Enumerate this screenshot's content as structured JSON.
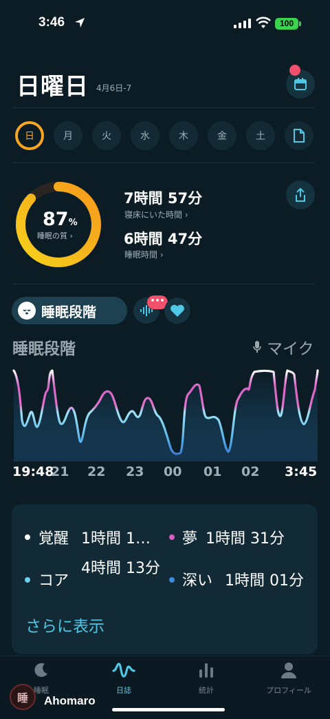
{
  "status": {
    "time": "3:46",
    "battery": "100"
  },
  "header": {
    "day": "日曜日",
    "date_range": "4月6日-7"
  },
  "week": [
    "日",
    "月",
    "火",
    "水",
    "木",
    "金",
    "土"
  ],
  "summary": {
    "quality_percent": "87",
    "quality_unit": "%",
    "quality_label": "睡眠の質 ›",
    "time_in_bed_value": "7時間 57分",
    "time_in_bed_label": "寝床にいた時間 ›",
    "sleep_time_value": "6時間 47分",
    "sleep_time_label": "睡眠時間 ›",
    "quality_fraction": 0.87
  },
  "stage_tab": {
    "label": "睡眠段階",
    "bubble": "•••"
  },
  "chart": {
    "title": "睡眠段階",
    "mic_label": "マイク",
    "x_labels": [
      "19:48",
      "21",
      "22",
      "23",
      "00",
      "01",
      "02",
      "3:45"
    ]
  },
  "legend": [
    {
      "name": "覚醒",
      "value": "1時間 1…",
      "color": "#ffffff"
    },
    {
      "name": "夢",
      "value": "1時間 31分",
      "color": "#d65fc0"
    },
    {
      "name": "コア",
      "value": "4時間 13分",
      "color": "#6fd0ec"
    },
    {
      "name": "深い",
      "value": "1時間 01分",
      "color": "#3f8be0"
    }
  ],
  "more_label": "さらに表示",
  "tabs": [
    "睡眠",
    "日誌",
    "統計",
    "プロフィール"
  ],
  "watermark": "Ahomaro",
  "colors": {
    "accent": "#4fc8e6",
    "ring": "#f6a623",
    "alert": "#f0506a"
  }
}
